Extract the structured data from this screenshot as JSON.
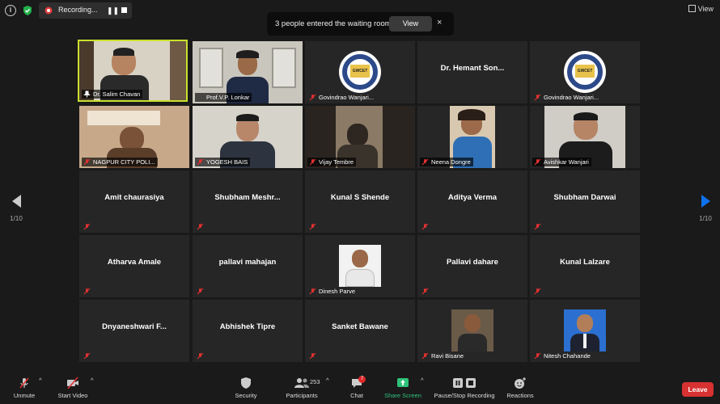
{
  "topbar": {
    "recording_label": "Recording...",
    "view_label": "View"
  },
  "banner": {
    "text": "3 people entered the waiting room",
    "view_button": "View",
    "close": "×"
  },
  "pagination": {
    "left": "1/10",
    "right": "1/10"
  },
  "tiles": [
    {
      "name": "Dr. Salim Chavan",
      "video": true
    },
    {
      "name": "Prof.V.P. Lonkar",
      "video": true
    },
    {
      "name": "Govindrao Wanjari...",
      "video": true
    },
    {
      "name": "Dr. Hemant  Son...",
      "video": false
    },
    {
      "name": "Govindrao Wanjari...",
      "video": true
    },
    {
      "name": "NAGPUR CITY POLI...",
      "video": true
    },
    {
      "name": "YOGESH BAIS",
      "video": true
    },
    {
      "name": "Vijay Tembre",
      "video": true
    },
    {
      "name": "Neena Dongre",
      "video": true
    },
    {
      "name": "Avishkar Wanjari",
      "video": true
    },
    {
      "name": "Amit chaurasiya",
      "video": false
    },
    {
      "name": "Shubham  Meshr...",
      "video": false
    },
    {
      "name": "Kunal S Shende",
      "video": false
    },
    {
      "name": "Aditya Verma",
      "video": false
    },
    {
      "name": "Shubham Darwai",
      "video": false
    },
    {
      "name": "Atharva Amale",
      "video": false
    },
    {
      "name": "pallavi mahajan",
      "video": false
    },
    {
      "name": "Dinesh Parve",
      "video": true
    },
    {
      "name": "Pallavi dahare",
      "video": false
    },
    {
      "name": "Kunal Lalzare",
      "video": false
    },
    {
      "name": "Dnyaneshwari  F...",
      "video": false
    },
    {
      "name": "Abhishek Tipre",
      "video": false
    },
    {
      "name": "Sanket Bawane",
      "video": false
    },
    {
      "name": "Ravi Bisane",
      "video": true
    },
    {
      "name": "Nitesh Chahande",
      "video": true
    }
  ],
  "toolbar": {
    "unmute": "Unmute",
    "start_video": "Start Video",
    "security": "Security",
    "participants": "Participants",
    "participant_count": "253",
    "chat": "Chat",
    "chat_badge": "7",
    "share_screen": "Share Screen",
    "pause_stop_recording": "Pause/Stop Recording",
    "reactions": "Reactions",
    "leave": "Leave"
  },
  "colors": {
    "active_speaker_border": "#c8e02e",
    "leave": "#d83131",
    "share": "#2fc27a",
    "nav_arrow": "#0e72ed"
  }
}
